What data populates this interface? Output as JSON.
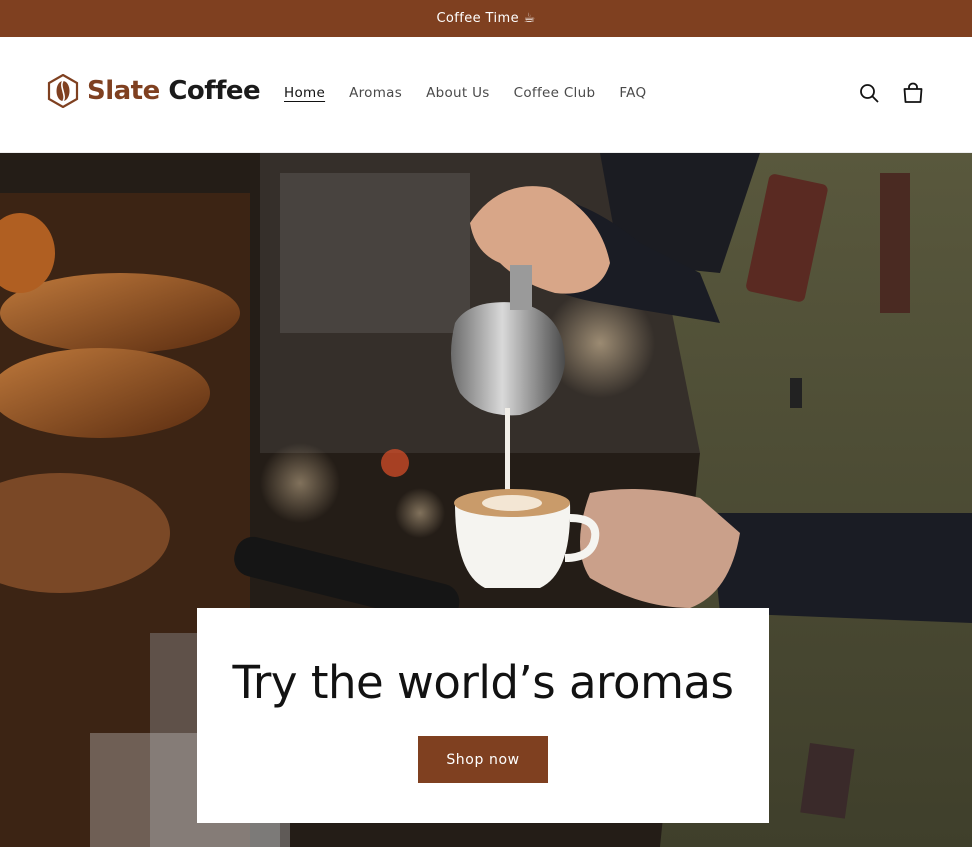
{
  "announcement": {
    "text": "Coffee Time ☕"
  },
  "header": {
    "logo": {
      "part1": "Slate",
      "part2": "Coffee"
    },
    "nav": [
      {
        "label": "Home",
        "active": true
      },
      {
        "label": "Aromas"
      },
      {
        "label": "About Us"
      },
      {
        "label": "Coffee Club"
      },
      {
        "label": "FAQ"
      }
    ],
    "icons": [
      "search-icon",
      "cart-icon"
    ]
  },
  "hero": {
    "title": "Try the world’s aromas",
    "cta_label": "Shop now"
  },
  "colors": {
    "brand": "#7f4020",
    "text": "#121212",
    "background": "#ffffff"
  }
}
